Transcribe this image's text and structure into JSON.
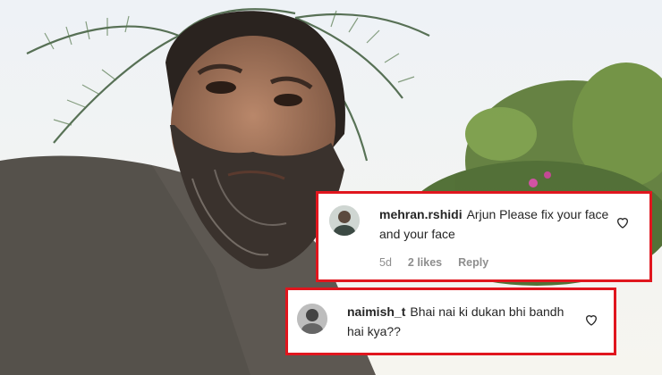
{
  "comments": [
    {
      "username": "mehran.rshidi",
      "text": "Arjun Please fix your face and your face",
      "age": "5d",
      "likes": "2 likes",
      "reply": "Reply",
      "avatar_icon": "user-avatar-icon",
      "like_icon": "heart-outline-icon"
    },
    {
      "username": "naimish_t",
      "text": "Bhai nai ki dukan bhi bandh hai kya??",
      "avatar_icon": "user-avatar-icon",
      "like_icon": "heart-outline-icon"
    }
  ],
  "highlight_color": "#e0161e"
}
